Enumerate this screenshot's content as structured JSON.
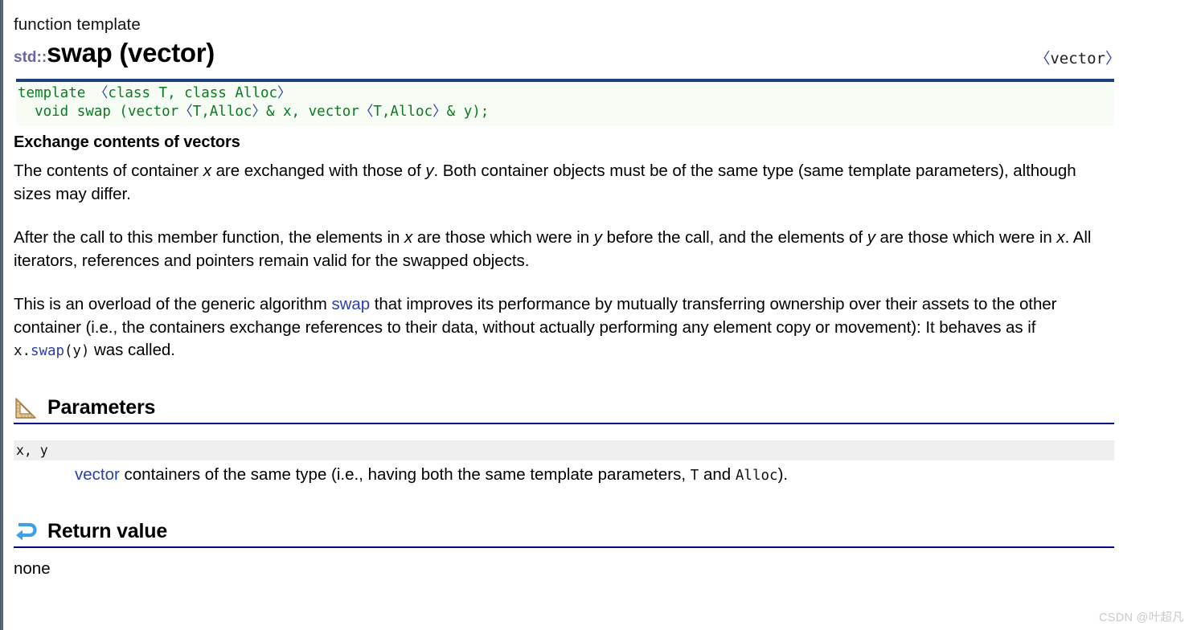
{
  "header": {
    "kind": "function template",
    "namespace": "std::",
    "name": "swap (vector)",
    "header_file": "vector",
    "header_file_open": "〈",
    "header_file_close": "〉"
  },
  "prototype": {
    "line1_a": "template ",
    "line1_open": "〈",
    "line1_b": "class T, class Alloc",
    "line1_close": "〉",
    "line2_a": "  void swap (vector",
    "line2_open": "〈",
    "line2_b": "T,Alloc",
    "line2_close": "〉",
    "line2_c": "& x, vector",
    "line2_open2": "〈",
    "line2_d": "T,Alloc",
    "line2_close2": "〉",
    "line2_e": "& y);"
  },
  "summary": {
    "subhead": "Exchange contents of vectors",
    "p1_part1": "The contents of container ",
    "p1_x": "x",
    "p1_part2": " are exchanged with those of ",
    "p1_y": "y",
    "p1_part3": ". Both container objects must be of the same type (same template parameters), although sizes may differ.",
    "p2_part1": "After the call to this member function, the elements in ",
    "p2_x1": "x",
    "p2_part2": " are those which were in ",
    "p2_y1": "y",
    "p2_part3": " before the call, and the elements of ",
    "p2_y2": "y",
    "p2_part4": " are those which were in ",
    "p2_x2": "x",
    "p2_part5": ". All iterators, references and pointers remain valid for the swapped objects.",
    "p3_part1": "This is an overload of the generic algorithm ",
    "p3_link": "swap",
    "p3_part2": " that improves its performance by mutually transferring ownership over their assets to the other container (i.e., the containers exchange references to their data, without actually performing any element copy or movement): It behaves as if ",
    "p3_code_a": "x.",
    "p3_code_link": "swap",
    "p3_code_b": "(y)",
    "p3_part3": " was called."
  },
  "parameters": {
    "heading": "Parameters",
    "icon": "triangle-ruler-icon",
    "param_name": "x, y",
    "desc_link": "vector",
    "desc_part1": " containers of the same type (i.e., having both the same template parameters, ",
    "desc_code_t": "T",
    "desc_part2": " and ",
    "desc_code_alloc": "Alloc",
    "desc_part3": ")."
  },
  "return_value": {
    "heading": "Return value",
    "icon": "return-arrow-icon",
    "text": "none"
  },
  "watermark": "CSDN @叶超凡",
  "colors": {
    "accent_blue": "#2b3fa8",
    "rule_blue": "#00008b",
    "code_green": "#0a7a22",
    "code_bg": "#f7fdf4",
    "proto_border": "#1f3f7a",
    "namespace": "#6666aa",
    "band_gray": "#efefef"
  }
}
